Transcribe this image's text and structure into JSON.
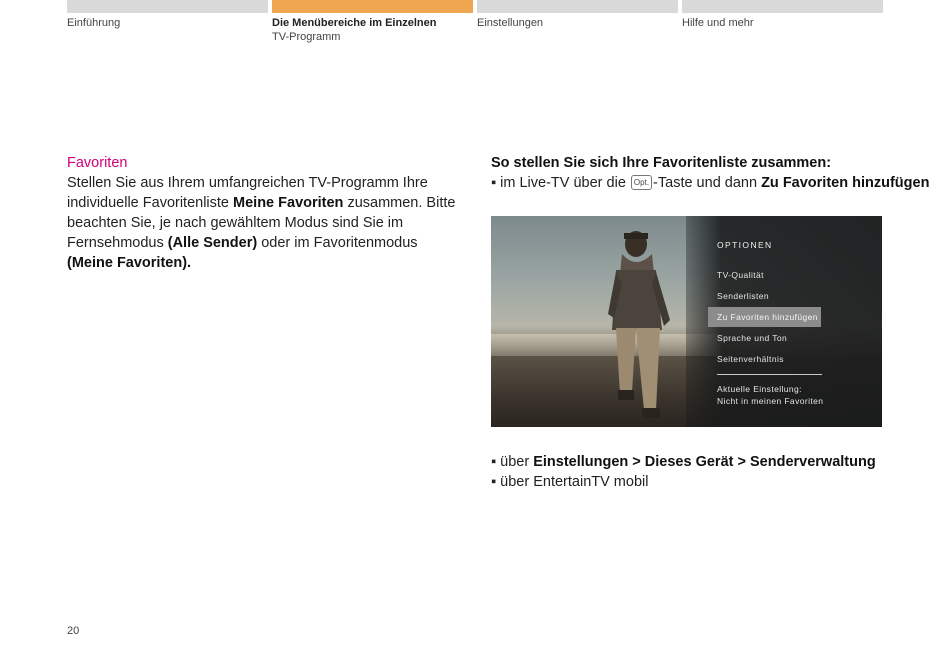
{
  "tabs": [
    {
      "label": "Einführung",
      "active": false
    },
    {
      "label": "Die Menübereiche im Einzelnen",
      "sub": "TV-Programm",
      "active": true
    },
    {
      "label": "Einstellungen",
      "active": false
    },
    {
      "label": "Hilfe und mehr",
      "active": false
    }
  ],
  "colors": {
    "accent_orange": "#f0a651",
    "magenta": "#d1007a",
    "tab_gray": "#d9d9d9"
  },
  "left": {
    "title": "Favoriten",
    "p1": "Stellen Sie aus Ihrem umfangreichen TV-Programm Ihre individuelle Favoritenliste ",
    "b1": "Meine Favoriten",
    "p2": " zusammen. Bitte beachten Sie, je nach gewähltem Modus sind Sie im Fernsehmodus ",
    "b2": "(Alle Sender)",
    "p3": " oder im Favoritenmodus ",
    "b3": "(Meine Favoriten)."
  },
  "right": {
    "title": "So stellen Sie sich Ihre Favoritenliste zusammen:",
    "bullet1": {
      "pre": "▪ im Live-TV über die ",
      "key": "Opt.",
      "mid": "-Taste und dann ",
      "bold": "Zu Favoriten hinzufügen"
    },
    "bullet2": {
      "pre": "▪ über ",
      "bold": "Einstellungen > Dieses Gerät > Senderverwaltung"
    },
    "bullet3": {
      "text": "▪ über EntertainTV mobil"
    }
  },
  "screen_menu": {
    "title": "OPTIONEN",
    "items": [
      "TV-Qualität",
      "Senderlisten",
      "Zu Favoriten hinzufügen",
      "Sprache und Ton",
      "Seitenverhältnis"
    ],
    "selected_index": 2,
    "current_label": "Aktuelle Einstellung:",
    "current_value": "Nicht in meinen Favoriten"
  },
  "page_number": "20"
}
